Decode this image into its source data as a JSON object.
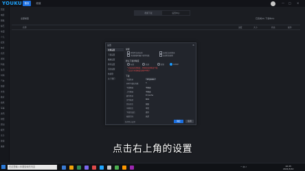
{
  "app": {
    "logo": "YOUKU",
    "tabs": [
      "首页",
      "频道"
    ],
    "window_controls": [
      "—",
      "□",
      "✕"
    ]
  },
  "sidebar": {
    "items": [
      "首页",
      "电影",
      "剧集",
      "综艺",
      "动漫",
      "少儿",
      "纪录",
      "体育",
      "音乐",
      "游戏",
      "科技",
      "生活",
      "时尚",
      "汽车",
      "旅游",
      "文化",
      "教育",
      "搞笑",
      "军事",
      "资讯",
      "财经",
      "原创",
      "娱乐",
      "亲子",
      "健康",
      "美食"
    ]
  },
  "sub_tabs": [
    "视频下载",
    "设置中心"
  ],
  "filter": {
    "label": "全部类型",
    "right": "已完成(0) 下载中(0)"
  },
  "table": {
    "headers": [
      "名称",
      "进度",
      "大小",
      "状态",
      "操作"
    ]
  },
  "dialog": {
    "title": "设置",
    "close": "×",
    "nav": [
      "常规设置",
      "下载设置",
      "播放设置",
      "转码设置",
      "消息提醒",
      "快捷键",
      "关于我们"
    ],
    "sections": {
      "general": "常规",
      "general_options": [
        "开机时自动启动",
        "启动后自动登录",
        "关闭面板时最小化到托盘",
        "自动检查更新"
      ],
      "quality_label": "默认下载清晰度",
      "quality_options": [
        "标清",
        "高清",
        "超清",
        "1080P"
      ],
      "warning1": "* 若无当前清晰度，则按较低清晰度下载",
      "warning2": "* 会员专享清晰度仅限VIP用户",
      "download": "下载",
      "dir_label": "下载目录",
      "dir_value": "D:\\youku",
      "rows": [
        {
          "label": "同时下载任务数",
          "value": "3"
        },
        {
          "label": "下载限速",
          "value": "不限速"
        },
        {
          "label": "上传限速",
          "value": "不限速"
        },
        {
          "label": "缓存目录",
          "value": "D:\\cache"
        },
        {
          "label": "文件格式",
          "value": "MP4"
        },
        {
          "label": "音轨语言",
          "value": "国语"
        },
        {
          "label": "字幕语言",
          "value": "中文"
        },
        {
          "label": "下载完成后",
          "value": "提示"
        },
        {
          "label": "磁盘空间",
          "value": "充足"
        }
      ]
    },
    "footer": "恢复默认设置",
    "ok": "确定",
    "cancel": "取消"
  },
  "subtitle": "点击右上角的设置",
  "taskbar": {
    "search": "在这里输入你要搜索的内容",
    "icons": [
      "#3a7bd5",
      "#f0a30a",
      "#2e8b57",
      "#7b68ee",
      "#e04a4a",
      "#1fa5ff",
      "#c8c8c8",
      "#4caf50",
      "#ff9800",
      "#9c27b0"
    ],
    "tray": "^ 中 ♪",
    "time": "10:25",
    "date": "2021/3/10"
  }
}
